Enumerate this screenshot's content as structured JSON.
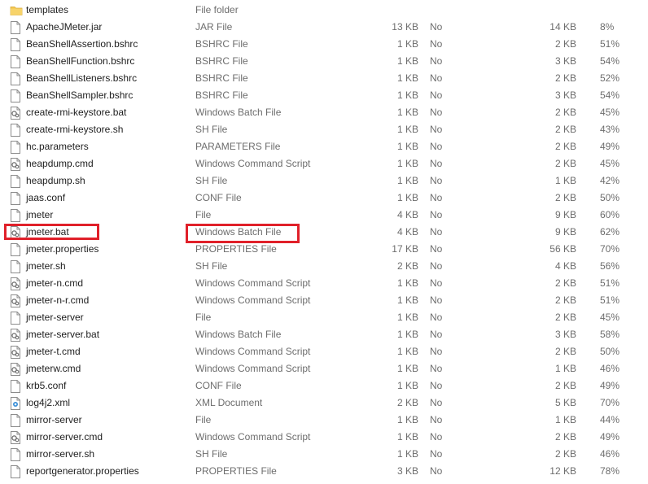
{
  "files": [
    {
      "name": "templates",
      "type": "File folder",
      "size": "",
      "encrypted": "",
      "packed": "",
      "ratio": "",
      "icon": "folder-icon"
    },
    {
      "name": "ApacheJMeter.jar",
      "type": "JAR File",
      "size": "13 KB",
      "encrypted": "No",
      "packed": "14 KB",
      "ratio": "8%",
      "icon": "file-icon"
    },
    {
      "name": "BeanShellAssertion.bshrc",
      "type": "BSHRC File",
      "size": "1 KB",
      "encrypted": "No",
      "packed": "2 KB",
      "ratio": "51%",
      "icon": "file-icon"
    },
    {
      "name": "BeanShellFunction.bshrc",
      "type": "BSHRC File",
      "size": "1 KB",
      "encrypted": "No",
      "packed": "3 KB",
      "ratio": "54%",
      "icon": "file-icon"
    },
    {
      "name": "BeanShellListeners.bshrc",
      "type": "BSHRC File",
      "size": "1 KB",
      "encrypted": "No",
      "packed": "2 KB",
      "ratio": "52%",
      "icon": "file-icon"
    },
    {
      "name": "BeanShellSampler.bshrc",
      "type": "BSHRC File",
      "size": "1 KB",
      "encrypted": "No",
      "packed": "3 KB",
      "ratio": "54%",
      "icon": "file-icon"
    },
    {
      "name": "create-rmi-keystore.bat",
      "type": "Windows Batch File",
      "size": "1 KB",
      "encrypted": "No",
      "packed": "2 KB",
      "ratio": "45%",
      "icon": "gear-file-icon"
    },
    {
      "name": "create-rmi-keystore.sh",
      "type": "SH File",
      "size": "1 KB",
      "encrypted": "No",
      "packed": "2 KB",
      "ratio": "43%",
      "icon": "file-icon"
    },
    {
      "name": "hc.parameters",
      "type": "PARAMETERS File",
      "size": "1 KB",
      "encrypted": "No",
      "packed": "2 KB",
      "ratio": "49%",
      "icon": "file-icon"
    },
    {
      "name": "heapdump.cmd",
      "type": "Windows Command Script",
      "size": "1 KB",
      "encrypted": "No",
      "packed": "2 KB",
      "ratio": "45%",
      "icon": "gear-file-icon"
    },
    {
      "name": "heapdump.sh",
      "type": "SH File",
      "size": "1 KB",
      "encrypted": "No",
      "packed": "1 KB",
      "ratio": "42%",
      "icon": "file-icon"
    },
    {
      "name": "jaas.conf",
      "type": "CONF File",
      "size": "1 KB",
      "encrypted": "No",
      "packed": "2 KB",
      "ratio": "50%",
      "icon": "file-icon"
    },
    {
      "name": "jmeter",
      "type": "File",
      "size": "4 KB",
      "encrypted": "No",
      "packed": "9 KB",
      "ratio": "60%",
      "icon": "file-icon"
    },
    {
      "name": "jmeter.bat",
      "type": "Windows Batch File",
      "size": "4 KB",
      "encrypted": "No",
      "packed": "9 KB",
      "ratio": "62%",
      "icon": "gear-file-icon"
    },
    {
      "name": "jmeter.properties",
      "type": "PROPERTIES File",
      "size": "17 KB",
      "encrypted": "No",
      "packed": "56 KB",
      "ratio": "70%",
      "icon": "file-icon"
    },
    {
      "name": "jmeter.sh",
      "type": "SH File",
      "size": "2 KB",
      "encrypted": "No",
      "packed": "4 KB",
      "ratio": "56%",
      "icon": "file-icon"
    },
    {
      "name": "jmeter-n.cmd",
      "type": "Windows Command Script",
      "size": "1 KB",
      "encrypted": "No",
      "packed": "2 KB",
      "ratio": "51%",
      "icon": "gear-file-icon"
    },
    {
      "name": "jmeter-n-r.cmd",
      "type": "Windows Command Script",
      "size": "1 KB",
      "encrypted": "No",
      "packed": "2 KB",
      "ratio": "51%",
      "icon": "gear-file-icon"
    },
    {
      "name": "jmeter-server",
      "type": "File",
      "size": "1 KB",
      "encrypted": "No",
      "packed": "2 KB",
      "ratio": "45%",
      "icon": "file-icon"
    },
    {
      "name": "jmeter-server.bat",
      "type": "Windows Batch File",
      "size": "1 KB",
      "encrypted": "No",
      "packed": "3 KB",
      "ratio": "58%",
      "icon": "gear-file-icon"
    },
    {
      "name": "jmeter-t.cmd",
      "type": "Windows Command Script",
      "size": "1 KB",
      "encrypted": "No",
      "packed": "2 KB",
      "ratio": "50%",
      "icon": "gear-file-icon"
    },
    {
      "name": "jmeterw.cmd",
      "type": "Windows Command Script",
      "size": "1 KB",
      "encrypted": "No",
      "packed": "1 KB",
      "ratio": "46%",
      "icon": "gear-file-icon"
    },
    {
      "name": "krb5.conf",
      "type": "CONF File",
      "size": "1 KB",
      "encrypted": "No",
      "packed": "2 KB",
      "ratio": "49%",
      "icon": "file-icon"
    },
    {
      "name": "log4j2.xml",
      "type": "XML Document",
      "size": "2 KB",
      "encrypted": "No",
      "packed": "5 KB",
      "ratio": "70%",
      "icon": "xml-file-icon"
    },
    {
      "name": "mirror-server",
      "type": "File",
      "size": "1 KB",
      "encrypted": "No",
      "packed": "1 KB",
      "ratio": "44%",
      "icon": "file-icon"
    },
    {
      "name": "mirror-server.cmd",
      "type": "Windows Command Script",
      "size": "1 KB",
      "encrypted": "No",
      "packed": "2 KB",
      "ratio": "49%",
      "icon": "gear-file-icon"
    },
    {
      "name": "mirror-server.sh",
      "type": "SH File",
      "size": "1 KB",
      "encrypted": "No",
      "packed": "2 KB",
      "ratio": "46%",
      "icon": "file-icon"
    },
    {
      "name": "reportgenerator.properties",
      "type": "PROPERTIES File",
      "size": "3 KB",
      "encrypted": "No",
      "packed": "12 KB",
      "ratio": "78%",
      "icon": "file-icon"
    }
  ],
  "highlighted": [
    "jmeter.bat",
    "Windows Batch File"
  ],
  "colors": {
    "highlight": "#e0202a",
    "folder": "#f3c54a",
    "name_text": "#1e1e1e",
    "meta_text": "#6d6d6d"
  }
}
